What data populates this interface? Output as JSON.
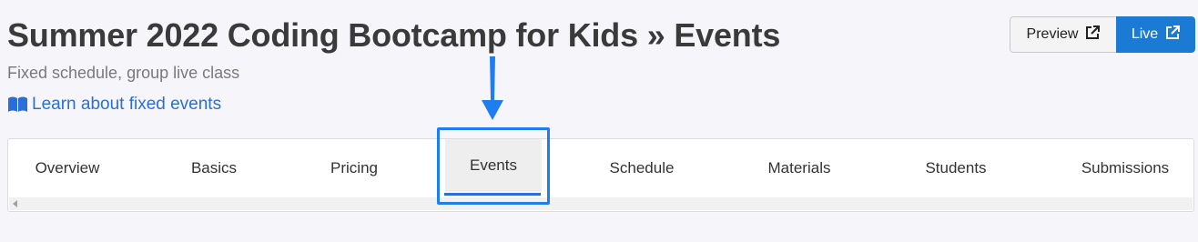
{
  "header": {
    "title": "Summer 2022 Coding Bootcamp for Kids » Events",
    "subtitle": "Fixed schedule, group live class",
    "learn_link": "Learn about fixed events",
    "learn_icon": "book-icon"
  },
  "actions": {
    "preview_label": "Preview",
    "live_label": "Live",
    "external_icon": "external-link-icon"
  },
  "tabs": [
    {
      "label": "Overview",
      "active": false
    },
    {
      "label": "Basics",
      "active": false
    },
    {
      "label": "Pricing",
      "active": false
    },
    {
      "label": "Events",
      "active": true
    },
    {
      "label": "Schedule",
      "active": false
    },
    {
      "label": "Materials",
      "active": false
    },
    {
      "label": "Students",
      "active": false
    },
    {
      "label": "Submissions",
      "active": false
    }
  ],
  "colors": {
    "accent": "#2a6fd9",
    "live_button": "#1a7ad4",
    "highlight": "#1e7ef0",
    "background": "#f6f5f9"
  }
}
